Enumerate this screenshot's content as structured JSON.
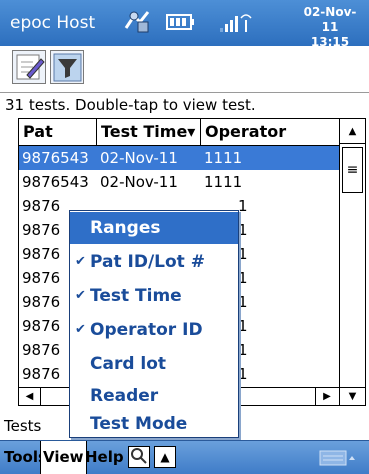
{
  "titlebar": {
    "app_title": "epoc Host",
    "date": "02-Nov-11",
    "time": "13:15"
  },
  "toolbar": {
    "edit_icon": "edit-pencil-icon",
    "filter_icon": "filter-funnel-icon"
  },
  "hint": "31 tests. Double-tap to view test.",
  "grid": {
    "columns": [
      "Pat",
      "Test Time▾",
      "Operator"
    ],
    "rows": [
      {
        "pat": "9876543",
        "time": "02-Nov-11",
        "op": "1111"
      },
      {
        "pat": "9876543",
        "time": "02-Nov-11",
        "op": "1111"
      },
      {
        "pat": "9876",
        "time": "",
        "op": "1"
      },
      {
        "pat": "9876",
        "time": "",
        "op": "1"
      },
      {
        "pat": "9876",
        "time": "",
        "op": "1"
      },
      {
        "pat": "9876",
        "time": "",
        "op": "1"
      },
      {
        "pat": "9876",
        "time": "",
        "op": "1"
      },
      {
        "pat": "9876",
        "time": "",
        "op": "1"
      },
      {
        "pat": "9876",
        "time": "",
        "op": "1"
      },
      {
        "pat": "9876",
        "time": "",
        "op": "1"
      }
    ]
  },
  "status_prefix": "Tests",
  "menubar": {
    "tools": "Tools",
    "view": "View",
    "help": "Help",
    "zoom_icon": "magnifier-icon",
    "up_icon": "arrow-up-icon",
    "keyboard_icon": "keyboard-icon"
  },
  "popup": {
    "items": [
      {
        "label": "Ranges",
        "checked": false
      },
      {
        "label": "Pat ID/Lot #",
        "checked": true
      },
      {
        "label": "Test Time",
        "checked": true
      },
      {
        "label": "Operator ID",
        "checked": true
      },
      {
        "label": "Card lot",
        "checked": false
      },
      {
        "label": "Reader",
        "checked": false
      },
      {
        "label": "Test Mode",
        "checked": false
      }
    ],
    "check_glyph": "✔"
  },
  "colors": {
    "titlebar": "#2d6fbe",
    "selected_row": "#3a7ad6",
    "menu_text": "#1a4c9a",
    "menu_highlight": "#2f6fc8"
  }
}
